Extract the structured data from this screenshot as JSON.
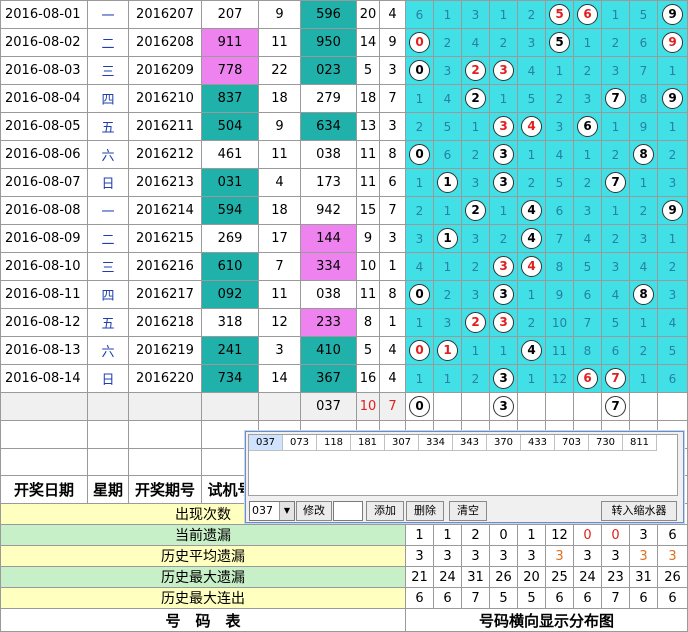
{
  "draws": [
    {
      "date": "2016-08-01",
      "week": "一",
      "issue": "2016207",
      "test": "207",
      "span": "9",
      "num": "596",
      "sum": "20",
      "tail": "4",
      "test_hl": "",
      "num_hl": "teal",
      "dist": [
        [
          "6",
          ""
        ],
        [
          "1",
          ""
        ],
        [
          "3",
          ""
        ],
        [
          "1",
          ""
        ],
        [
          "2",
          ""
        ],
        [
          "5",
          "rb"
        ],
        [
          "6",
          "rb"
        ],
        [
          "1",
          ""
        ],
        [
          "5",
          ""
        ],
        [
          "9",
          "b"
        ]
      ]
    },
    {
      "date": "2016-08-02",
      "week": "二",
      "issue": "2016208",
      "test": "911",
      "span": "11",
      "num": "950",
      "sum": "14",
      "tail": "9",
      "test_hl": "pink",
      "num_hl": "teal",
      "dist": [
        [
          "0",
          "rb"
        ],
        [
          "2",
          ""
        ],
        [
          "4",
          ""
        ],
        [
          "2",
          ""
        ],
        [
          "3",
          ""
        ],
        [
          "5",
          "b"
        ],
        [
          "1",
          ""
        ],
        [
          "2",
          ""
        ],
        [
          "6",
          ""
        ],
        [
          "9",
          "rb"
        ]
      ]
    },
    {
      "date": "2016-08-03",
      "week": "三",
      "issue": "2016209",
      "test": "778",
      "span": "22",
      "num": "023",
      "sum": "5",
      "tail": "3",
      "test_hl": "pink",
      "num_hl": "teal",
      "dist": [
        [
          "0",
          "b"
        ],
        [
          "3",
          ""
        ],
        [
          "2",
          "rb"
        ],
        [
          "3",
          "rb"
        ],
        [
          "4",
          ""
        ],
        [
          "1",
          ""
        ],
        [
          "2",
          ""
        ],
        [
          "3",
          ""
        ],
        [
          "7",
          ""
        ],
        [
          "1",
          ""
        ]
      ]
    },
    {
      "date": "2016-08-04",
      "week": "四",
      "issue": "2016210",
      "test": "837",
      "span": "18",
      "num": "279",
      "sum": "18",
      "tail": "7",
      "test_hl": "teal",
      "num_hl": "",
      "dist": [
        [
          "1",
          ""
        ],
        [
          "4",
          ""
        ],
        [
          "2",
          "b"
        ],
        [
          "1",
          ""
        ],
        [
          "5",
          ""
        ],
        [
          "2",
          ""
        ],
        [
          "3",
          ""
        ],
        [
          "7",
          "b"
        ],
        [
          "8",
          ""
        ],
        [
          "9",
          "b"
        ]
      ]
    },
    {
      "date": "2016-08-05",
      "week": "五",
      "issue": "2016211",
      "test": "504",
      "span": "9",
      "num": "634",
      "sum": "13",
      "tail": "3",
      "test_hl": "teal",
      "num_hl": "teal",
      "dist": [
        [
          "2",
          ""
        ],
        [
          "5",
          ""
        ],
        [
          "1",
          ""
        ],
        [
          "3",
          "rb"
        ],
        [
          "4",
          "rb"
        ],
        [
          "3",
          ""
        ],
        [
          "6",
          "b"
        ],
        [
          "1",
          ""
        ],
        [
          "9",
          ""
        ],
        [
          "1",
          ""
        ]
      ]
    },
    {
      "date": "2016-08-06",
      "week": "六",
      "issue": "2016212",
      "test": "461",
      "span": "11",
      "num": "038",
      "sum": "11",
      "tail": "8",
      "test_hl": "",
      "num_hl": "",
      "dist": [
        [
          "0",
          "b"
        ],
        [
          "6",
          ""
        ],
        [
          "2",
          ""
        ],
        [
          "3",
          "b"
        ],
        [
          "1",
          ""
        ],
        [
          "4",
          ""
        ],
        [
          "1",
          ""
        ],
        [
          "2",
          ""
        ],
        [
          "8",
          "b"
        ],
        [
          "2",
          ""
        ]
      ]
    },
    {
      "date": "2016-08-07",
      "week": "日",
      "issue": "2016213",
      "test": "031",
      "span": "4",
      "num": "173",
      "sum": "11",
      "tail": "6",
      "test_hl": "teal",
      "num_hl": "",
      "dist": [
        [
          "1",
          ""
        ],
        [
          "1",
          "b"
        ],
        [
          "3",
          ""
        ],
        [
          "3",
          "b"
        ],
        [
          "2",
          ""
        ],
        [
          "5",
          ""
        ],
        [
          "2",
          ""
        ],
        [
          "7",
          "b"
        ],
        [
          "1",
          ""
        ],
        [
          "3",
          ""
        ]
      ]
    },
    {
      "date": "2016-08-08",
      "week": "一",
      "issue": "2016214",
      "test": "594",
      "span": "18",
      "num": "942",
      "sum": "15",
      "tail": "7",
      "test_hl": "teal",
      "num_hl": "",
      "dist": [
        [
          "2",
          ""
        ],
        [
          "1",
          ""
        ],
        [
          "2",
          "b"
        ],
        [
          "1",
          ""
        ],
        [
          "4",
          "b"
        ],
        [
          "6",
          ""
        ],
        [
          "3",
          ""
        ],
        [
          "1",
          ""
        ],
        [
          "2",
          ""
        ],
        [
          "9",
          "b"
        ]
      ]
    },
    {
      "date": "2016-08-09",
      "week": "二",
      "issue": "2016215",
      "test": "269",
      "span": "17",
      "num": "144",
      "sum": "9",
      "tail": "3",
      "test_hl": "",
      "num_hl": "pink",
      "dist": [
        [
          "3",
          ""
        ],
        [
          "1",
          "b"
        ],
        [
          "3",
          ""
        ],
        [
          "2",
          ""
        ],
        [
          "4",
          "b"
        ],
        [
          "7",
          ""
        ],
        [
          "4",
          ""
        ],
        [
          "2",
          ""
        ],
        [
          "3",
          ""
        ],
        [
          "1",
          ""
        ]
      ]
    },
    {
      "date": "2016-08-10",
      "week": "三",
      "issue": "2016216",
      "test": "610",
      "span": "7",
      "num": "334",
      "sum": "10",
      "tail": "1",
      "test_hl": "teal",
      "num_hl": "pink",
      "dist": [
        [
          "4",
          ""
        ],
        [
          "1",
          ""
        ],
        [
          "2",
          ""
        ],
        [
          "3",
          "rb"
        ],
        [
          "4",
          "rb"
        ],
        [
          "8",
          ""
        ],
        [
          "5",
          ""
        ],
        [
          "3",
          ""
        ],
        [
          "4",
          ""
        ],
        [
          "2",
          ""
        ]
      ]
    },
    {
      "date": "2016-08-11",
      "week": "四",
      "issue": "2016217",
      "test": "092",
      "span": "11",
      "num": "038",
      "sum": "11",
      "tail": "8",
      "test_hl": "teal",
      "num_hl": "",
      "dist": [
        [
          "0",
          "b"
        ],
        [
          "2",
          ""
        ],
        [
          "3",
          ""
        ],
        [
          "3",
          "b"
        ],
        [
          "1",
          ""
        ],
        [
          "9",
          ""
        ],
        [
          "6",
          ""
        ],
        [
          "4",
          ""
        ],
        [
          "8",
          "b"
        ],
        [
          "3",
          ""
        ]
      ]
    },
    {
      "date": "2016-08-12",
      "week": "五",
      "issue": "2016218",
      "test": "318",
      "span": "12",
      "num": "233",
      "sum": "8",
      "tail": "1",
      "test_hl": "",
      "num_hl": "pink",
      "dist": [
        [
          "1",
          ""
        ],
        [
          "3",
          ""
        ],
        [
          "2",
          "rb"
        ],
        [
          "3",
          "rb"
        ],
        [
          "2",
          ""
        ],
        [
          "10",
          ""
        ],
        [
          "7",
          ""
        ],
        [
          "5",
          ""
        ],
        [
          "1",
          ""
        ],
        [
          "4",
          ""
        ]
      ]
    },
    {
      "date": "2016-08-13",
      "week": "六",
      "issue": "2016219",
      "test": "241",
      "span": "3",
      "num": "410",
      "sum": "5",
      "tail": "4",
      "test_hl": "teal",
      "num_hl": "teal",
      "dist": [
        [
          "0",
          "rb"
        ],
        [
          "1",
          "rb"
        ],
        [
          "1",
          ""
        ],
        [
          "1",
          ""
        ],
        [
          "4",
          "b"
        ],
        [
          "11",
          ""
        ],
        [
          "8",
          ""
        ],
        [
          "6",
          ""
        ],
        [
          "2",
          ""
        ],
        [
          "5",
          ""
        ]
      ]
    },
    {
      "date": "2016-08-14",
      "week": "日",
      "issue": "2016220",
      "test": "734",
      "span": "14",
      "num": "367",
      "sum": "16",
      "tail": "4",
      "test_hl": "teal",
      "num_hl": "teal",
      "dist": [
        [
          "1",
          ""
        ],
        [
          "1",
          ""
        ],
        [
          "2",
          ""
        ],
        [
          "3",
          "b"
        ],
        [
          "1",
          ""
        ],
        [
          "12",
          ""
        ],
        [
          "6",
          "rb"
        ],
        [
          "7",
          "rb"
        ],
        [
          "1",
          ""
        ],
        [
          "6",
          ""
        ]
      ]
    }
  ],
  "pending": {
    "num": "037",
    "sum": "10",
    "tail": "7",
    "balls": [
      [
        "0",
        "b"
      ],
      [
        "",
        ""
      ],
      [
        "",
        ""
      ],
      [
        "3",
        "b"
      ],
      [
        "",
        ""
      ],
      [
        "",
        ""
      ],
      [
        "",
        ""
      ],
      [
        "7",
        "b"
      ],
      [
        "",
        ""
      ],
      [
        "",
        ""
      ]
    ]
  },
  "header": {
    "date": "开奖日期",
    "week": "星期",
    "issue": "开奖期号",
    "test": "试机号"
  },
  "stats": {
    "labels": [
      "出现次数",
      "当前遗漏",
      "历史平均遗漏",
      "历史最大遗漏",
      "历史最大连出"
    ],
    "rows": [
      {
        "vals": [
          [
            "",
            ""
          ],
          [
            "",
            ""
          ],
          [
            "",
            ""
          ],
          [
            "",
            ""
          ],
          [
            "",
            ""
          ],
          [
            "",
            ""
          ],
          [
            "",
            ""
          ],
          [
            "",
            ""
          ],
          [
            "",
            ""
          ],
          [
            "",
            ""
          ]
        ]
      },
      {
        "vals": [
          [
            "1",
            ""
          ],
          [
            "1",
            ""
          ],
          [
            "2",
            ""
          ],
          [
            "0",
            ""
          ],
          [
            "1",
            ""
          ],
          [
            "12",
            ""
          ],
          [
            "0",
            "red"
          ],
          [
            "0",
            "red"
          ],
          [
            "3",
            ""
          ],
          [
            "6",
            ""
          ]
        ]
      },
      {
        "vals": [
          [
            "3",
            ""
          ],
          [
            "3",
            ""
          ],
          [
            "3",
            ""
          ],
          [
            "3",
            ""
          ],
          [
            "3",
            ""
          ],
          [
            "3",
            "orange"
          ],
          [
            "3",
            ""
          ],
          [
            "3",
            ""
          ],
          [
            "3",
            "orange"
          ],
          [
            "3",
            "orange"
          ]
        ]
      },
      {
        "vals": [
          [
            "21",
            ""
          ],
          [
            "24",
            ""
          ],
          [
            "31",
            ""
          ],
          [
            "26",
            ""
          ],
          [
            "20",
            ""
          ],
          [
            "25",
            ""
          ],
          [
            "24",
            ""
          ],
          [
            "23",
            ""
          ],
          [
            "31",
            ""
          ],
          [
            "26",
            ""
          ]
        ]
      },
      {
        "vals": [
          [
            "6",
            ""
          ],
          [
            "6",
            ""
          ],
          [
            "7",
            ""
          ],
          [
            "5",
            ""
          ],
          [
            "5",
            ""
          ],
          [
            "6",
            ""
          ],
          [
            "6",
            ""
          ],
          [
            "7",
            ""
          ],
          [
            "6",
            ""
          ],
          [
            "6",
            ""
          ]
        ]
      }
    ]
  },
  "footer": {
    "left": "号　码　表",
    "right": "号码横向显示分布图"
  },
  "popup": {
    "list": [
      "037",
      "073",
      "118",
      "181",
      "307",
      "334",
      "343",
      "370",
      "433",
      "703",
      "730",
      "811"
    ],
    "combo_value": "037",
    "buttons": {
      "modify": "修改",
      "add": "添加",
      "delete": "删除",
      "clear": "清空",
      "convert": "转入缩水器"
    }
  },
  "colors": {
    "teal": "#20b2aa",
    "pink": "#ee82ee",
    "dist": "#40e0e6",
    "yellow": "#ffffc0",
    "green": "#c8f0c8",
    "red": "#e02020"
  }
}
